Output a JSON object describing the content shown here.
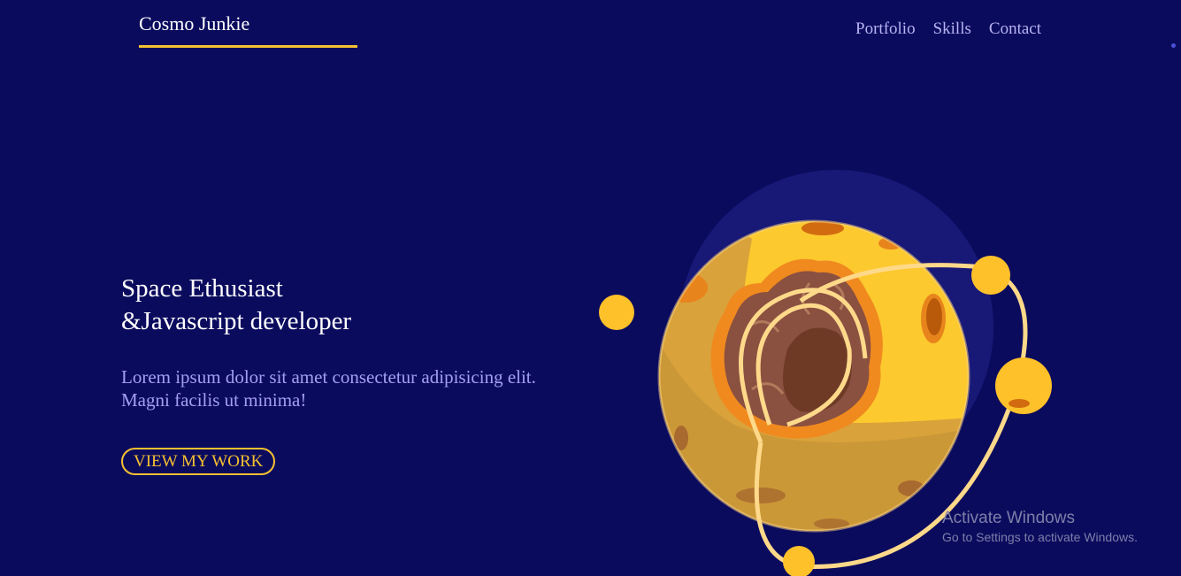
{
  "brand": {
    "name": "Cosmo Junkie"
  },
  "nav": [
    {
      "label": "Portfolio"
    },
    {
      "label": "Skills"
    },
    {
      "label": "Contact"
    }
  ],
  "hero": {
    "headline_line1": "Space Ethusiast",
    "headline_line2": "&Javascript developer",
    "blurb_line1": "Lorem ipsum dolor sit amet consectetur adipisicing elit.",
    "blurb_line2": "Magni facilis ut minima!",
    "cta_label": "VIEW MY WORK"
  },
  "watermark": {
    "title": "Activate Windows",
    "subtitle": "Go to Settings to activate Windows."
  },
  "colors": {
    "background": "#0b0b5e",
    "accent": "#f5c130",
    "nav_text": "#b7b3f1",
    "body_text": "#a39ff0"
  },
  "icons": [
    "planet-illustration",
    "moon-icon"
  ]
}
